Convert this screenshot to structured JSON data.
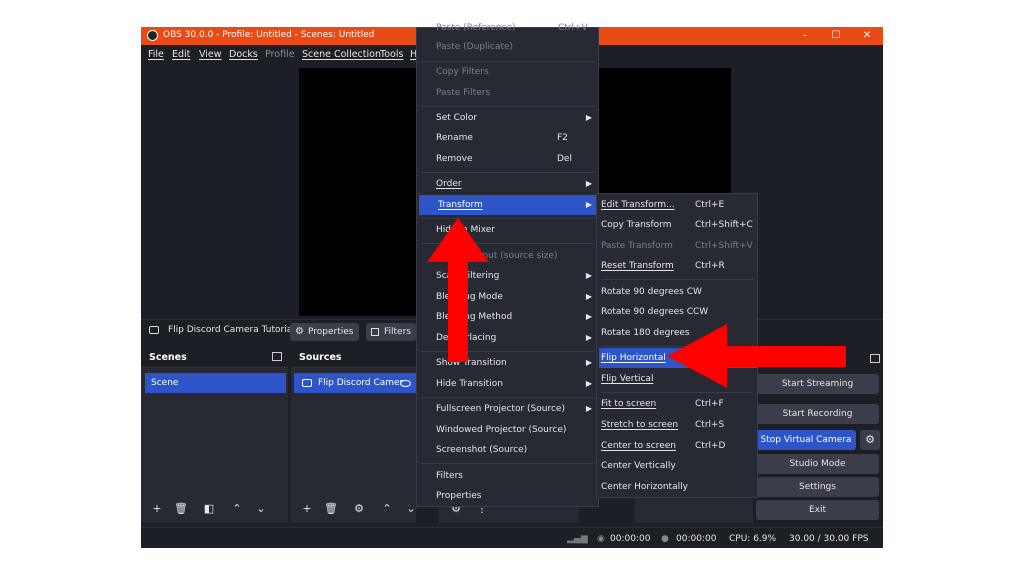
{
  "window": {
    "title": "OBS 30.0.0 - Profile: Untitled - Scenes: Untitled",
    "controls": {
      "minimize": "–",
      "maximize": "☐",
      "close": "✕"
    }
  },
  "menubar": [
    "File",
    "Edit",
    "View",
    "Docks",
    "Profile",
    "Scene Collection",
    "Tools",
    "H"
  ],
  "source_toolbar": {
    "source_name": "Flip Discord Camera Tutoria",
    "properties": "Properties",
    "filters": "Filters"
  },
  "scenes": {
    "title": "Scenes",
    "items": [
      "Scene"
    ]
  },
  "sources": {
    "title": "Sources",
    "items": [
      "Flip Discord Camer"
    ]
  },
  "controls": {
    "start_streaming": "Start Streaming",
    "start_recording": "Start Recording",
    "stop_virtual_camera": "Stop Virtual Camera",
    "studio_mode": "Studio Mode",
    "settings": "Settings",
    "exit": "Exit"
  },
  "status": {
    "stream_time": "00:00:00",
    "rec_time": "00:00:00",
    "cpu": "CPU: 6.9%",
    "fps": "30.00 / 30.00 FPS"
  },
  "context_menu": {
    "items": [
      {
        "label": "Paste (Reference)",
        "shortcut": "Ctrl+V",
        "disabled": true
      },
      {
        "label": "Paste (Duplicate)",
        "disabled": true
      },
      {
        "label": "Copy Filters",
        "disabled": true
      },
      {
        "label": "Paste Filters",
        "disabled": true
      },
      {
        "label": "Set Color"
      },
      {
        "label": "Rename",
        "shortcut": "F2"
      },
      {
        "label": "Remove",
        "shortcut": "Del"
      },
      {
        "label": "Order"
      },
      {
        "label": "Transform"
      },
      {
        "label": "Hide in Mixer"
      },
      {
        "label": "Resize output (source size)",
        "disabled": true
      },
      {
        "label": "Scale Filtering"
      },
      {
        "label": "Blending Mode"
      },
      {
        "label": "Blending Method"
      },
      {
        "label": "Deinterlacing"
      },
      {
        "label": "Show Transition"
      },
      {
        "label": "Hide Transition"
      },
      {
        "label": "Fullscreen Projector (Source)"
      },
      {
        "label": "Windowed Projector (Source)"
      },
      {
        "label": "Screenshot (Source)"
      },
      {
        "label": "Filters"
      },
      {
        "label": "Properties"
      }
    ]
  },
  "transform_menu": {
    "items": [
      {
        "label": "Edit Transform...",
        "shortcut": "Ctrl+E"
      },
      {
        "label": "Copy Transform",
        "shortcut": "Ctrl+Shift+C"
      },
      {
        "label": "Paste Transform",
        "shortcut": "Ctrl+Shift+V",
        "disabled": true
      },
      {
        "label": "Reset Transform",
        "shortcut": "Ctrl+R"
      },
      {
        "label": "Rotate 90 degrees CW"
      },
      {
        "label": "Rotate 90 degrees CCW"
      },
      {
        "label": "Rotate 180 degrees"
      },
      {
        "label": "Flip Horizontal"
      },
      {
        "label": "Flip Vertical"
      },
      {
        "label": "Fit to screen",
        "shortcut": "Ctrl+F"
      },
      {
        "label": "Stretch to screen",
        "shortcut": "Ctrl+S"
      },
      {
        "label": "Center to screen",
        "shortcut": "Ctrl+D"
      },
      {
        "label": "Center Vertically"
      },
      {
        "label": "Center Horizontally"
      }
    ]
  },
  "colors": {
    "titlebar": "#e84b16",
    "highlight": "#2d55c7",
    "arrow": "#ff0000"
  }
}
